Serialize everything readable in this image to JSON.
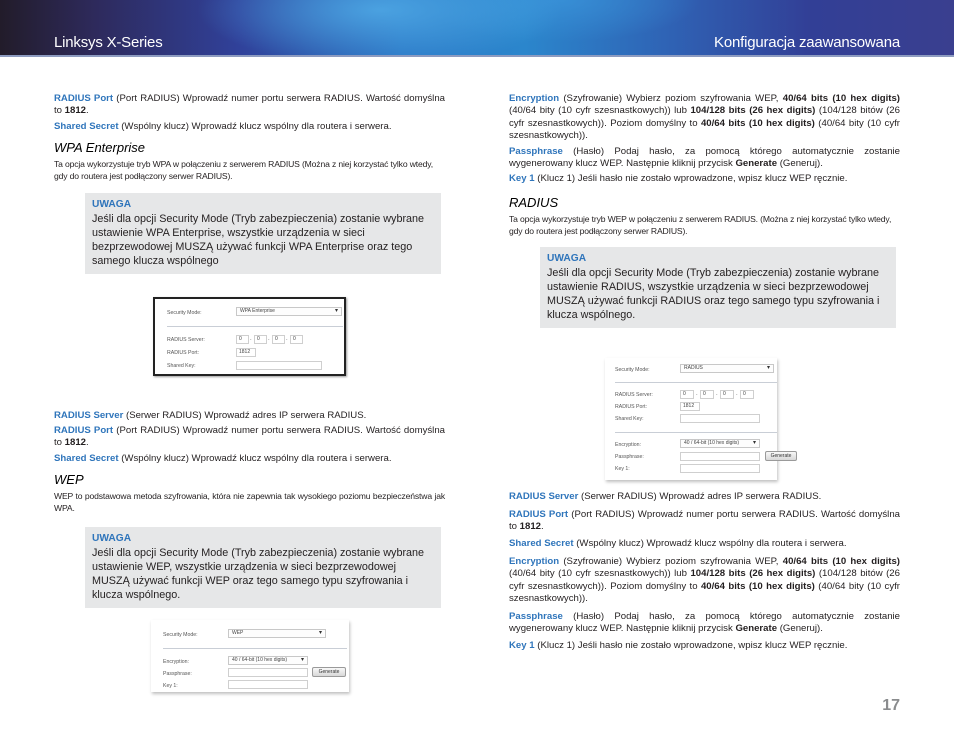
{
  "header": {
    "brand": "Linksys X-Series",
    "section": "Konfiguracja zaawansowana"
  },
  "left": {
    "radius_port": {
      "term": "RADIUS Port",
      "text": " (Port RADIUS) Wprowadź numer portu serwera RADIUS. Wartość domyślna to ",
      "value": "1812",
      "end": "."
    },
    "shared_secret": {
      "term": "Shared Secret",
      "text": " (Wspólny klucz) Wprowadź klucz wspólny dla routera i serwera."
    },
    "wpa_enterprise": {
      "heading": "WPA Enterprise",
      "desc": "Ta opcja wykorzystuje tryb WPA w połączeniu z serwerem RADIUS (Można z niej korzystać tylko wtedy, gdy do routera jest podłączony serwer RADIUS).",
      "note_title": "UWAGA",
      "note_text": "Jeśli dla opcji Security Mode (Tryb zabezpieczenia) zostanie wybrane ustawienie WPA Enterprise, wszystkie urządzenia w sieci bezprzewodowej MUSZĄ używać funkcji WPA Enterprise oraz tego samego klucza wspólnego"
    },
    "screenshot1": {
      "security_mode_label": "Security Mode:",
      "security_mode_value": "WPA Enterprise",
      "radius_server_label": "RADIUS Server:",
      "ip": [
        "0",
        "0",
        "0",
        "0"
      ],
      "radius_port_label": "RADIUS Port:",
      "radius_port_value": "1812",
      "shared_key_label": "Shared Key:",
      "shared_key_value": ""
    },
    "radius_server2": {
      "term": "RADIUS Server",
      "text": " (Serwer RADIUS) Wprowadź adres IP serwera RADIUS."
    },
    "radius_port2": {
      "term": "RADIUS Port",
      "text": " (Port RADIUS) Wprowadź numer portu serwera RADIUS. Wartość domyślna to ",
      "value": "1812",
      "end": "."
    },
    "shared_secret2": {
      "term": "Shared Secret",
      "text": " (Wspólny klucz) Wprowadź klucz wspólny dla routera i serwera."
    },
    "wep": {
      "heading": "WEP",
      "desc": "WEP to podstawowa metoda szyfrowania, która nie zapewnia tak wysokiego poziomu bezpieczeństwa jak WPA.",
      "note_title": "UWAGA",
      "note_text": "Jeśli dla opcji Security Mode (Tryb zabezpieczenia) zostanie wybrane ustawienie WEP, wszystkie urządzenia w sieci bezprzewodowej MUSZĄ używać funkcji WEP oraz tego samego typu szyfrowania i klucza wspólnego."
    },
    "screenshot2": {
      "security_mode_label": "Security Mode:",
      "security_mode_value": "WEP",
      "encryption_label": "Encryption:",
      "encryption_value": "40 / 64-bit (10 hex digits)",
      "passphrase_label": "Passphrase:",
      "passphrase_value": "",
      "generate_button": "Generate",
      "key1_label": "Key 1:",
      "key1_value": ""
    }
  },
  "right": {
    "encryption": {
      "term": "Encryption",
      "t1": " (Szyfrowanie) Wybierz poziom szyfrowania WEP, ",
      "b1": "40/64 bits (10 hex digits)",
      "t2": " (40/64 bity (10 cyfr szesnastkowych)) lub ",
      "b2": "104/128 bits (26 hex digits)",
      "t3": " (104/128 bitów (26 cyfr szesnastkowych)). Poziom domyślny to ",
      "b3": "40/64 bits (10 hex digits)",
      "t4": " (40/64 bity (10 cyfr szesnastkowych))."
    },
    "passphrase": {
      "term": "Passphrase",
      "t1": " (Hasło) Podaj hasło, za pomocą którego automatycznie zostanie wygenerowany klucz WEP. Następnie kliknij przycisk ",
      "b1": "Generate",
      "t2": " (Generuj)."
    },
    "key1": {
      "term": "Key 1",
      "text": " (Klucz 1) Jeśli hasło nie zostało wprowadzone, wpisz klucz WEP ręcznie."
    },
    "radius": {
      "heading": "RADIUS",
      "desc": "Ta opcja wykorzystuje tryb WEP w połączeniu z serwerem RADIUS. (Można z niej korzystać tylko wtedy, gdy do routera jest podłączony serwer RADIUS).",
      "note_title": "UWAGA",
      "note_text": "Jeśli dla opcji Security Mode (Tryb zabezpieczenia) zostanie wybrane ustawienie RADIUS, wszystkie urządzenia w sieci bezprzewodowej MUSZĄ używać funkcji RADIUS oraz tego samego typu szyfrowania i klucza wspólnego."
    },
    "screenshot3": {
      "security_mode_label": "Security Mode:",
      "security_mode_value": "RADIUS",
      "radius_server_label": "RADIUS Server:",
      "ip": [
        "0",
        "0",
        "0",
        "0"
      ],
      "radius_port_label": "RADIUS Port:",
      "radius_port_value": "1812",
      "shared_key_label": "Shared Key:",
      "shared_key_value": "",
      "encryption_label": "Encryption:",
      "encryption_value": "40 / 64-bit (10 hex digits)",
      "passphrase_label": "Passphrase:",
      "passphrase_value": "",
      "generate_button": "Generate",
      "key1_label": "Key 1:",
      "key1_value": ""
    },
    "radius_server": {
      "term": "RADIUS Server",
      "text": " (Serwer RADIUS) Wprowadź adres IP serwera RADIUS."
    },
    "radius_port": {
      "term": "RADIUS Port",
      "text": " (Port RADIUS) Wprowadź numer portu serwera RADIUS. Wartość domyślna to ",
      "value": "1812",
      "end": "."
    },
    "shared_secret": {
      "term": "Shared Secret",
      "text": " (Wspólny klucz) Wprowadź klucz wspólny dla routera i serwera."
    },
    "encryption2": {
      "term": "Encryption",
      "t1": " (Szyfrowanie) Wybierz poziom szyfrowania WEP, ",
      "b1": "40/64 bits (10 hex digits)",
      "t2": " (40/64 bity (10 cyfr szesnastkowych)) lub ",
      "b2": "104/128 bits (26 hex digits)",
      "t3": " (104/128 bitów (26 cyfr szesnastkowych)). Poziom domyślny to ",
      "b3": "40/64 bits (10 hex digits)",
      "t4": " (40/64 bity (10 cyfr szesnastkowych))."
    },
    "passphrase2": {
      "term": "Passphrase",
      "t1": " (Hasło) Podaj hasło, za pomocą którego automatycznie zostanie wygenerowany klucz WEP. Następnie kliknij przycisk ",
      "b1": "Generate",
      "t2": " (Generuj)."
    },
    "key1_2": {
      "term": "Key 1",
      "text": " (Klucz 1) Jeśli hasło nie zostało wprowadzone, wpisz klucz WEP ręcznie."
    }
  },
  "footer": {
    "page_number": "17"
  },
  "colors": {
    "accent": "#2f75bb",
    "note_bg": "#e6e7e8",
    "page_number": "#8a8c8e"
  }
}
